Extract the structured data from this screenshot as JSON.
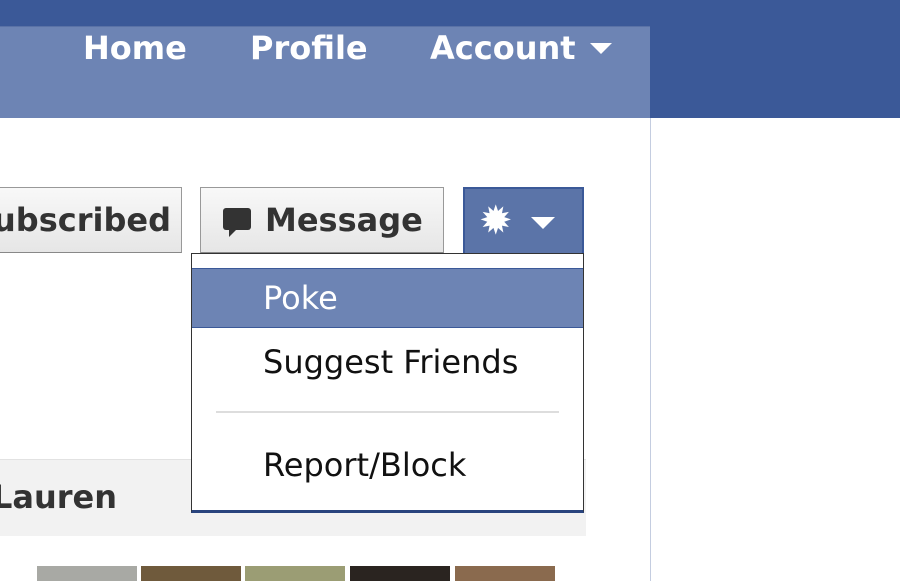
{
  "nav": {
    "home": "Home",
    "profile": "Profile",
    "account": "Account"
  },
  "actions": {
    "subscribed_label": "ubscribed",
    "message_label": "Message",
    "gear_icon": "gear-icon",
    "message_icon": "speech-bubble-icon"
  },
  "menu": {
    "items": [
      {
        "label": "Poke",
        "highlighted": true
      },
      {
        "label": "Suggest Friends"
      },
      {
        "label": "Report/Block"
      }
    ]
  },
  "friends": {
    "label": "Lauren"
  },
  "colors": {
    "brand_blue": "#3b5998",
    "nav_blue": "#6d84b4",
    "highlight": "#6d84b4"
  }
}
